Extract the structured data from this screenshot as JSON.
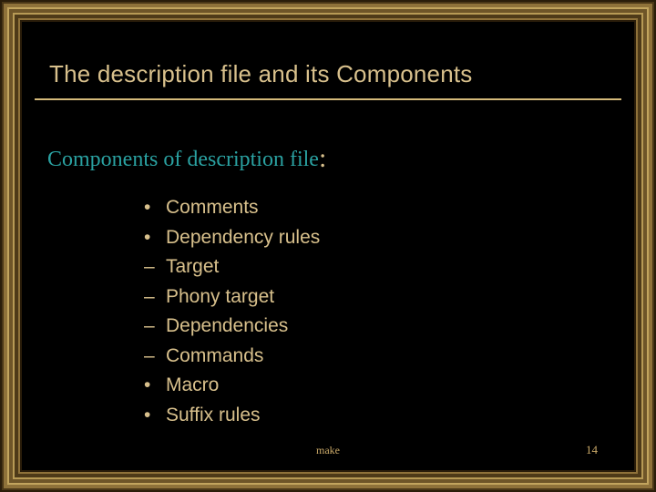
{
  "title": "The description file and its Components",
  "subtitle": {
    "label": "Components of description file",
    "suffix": ":"
  },
  "bullets": {
    "b0": "Comments",
    "b1": "Dependency rules",
    "b1_children": {
      "s0": "Target",
      "s1": "Phony target",
      "s2": "Dependencies",
      "s3": "Commands"
    },
    "b2": "Macro",
    "b3": "Suffix rules"
  },
  "footer": {
    "center": "make",
    "page": "14"
  }
}
